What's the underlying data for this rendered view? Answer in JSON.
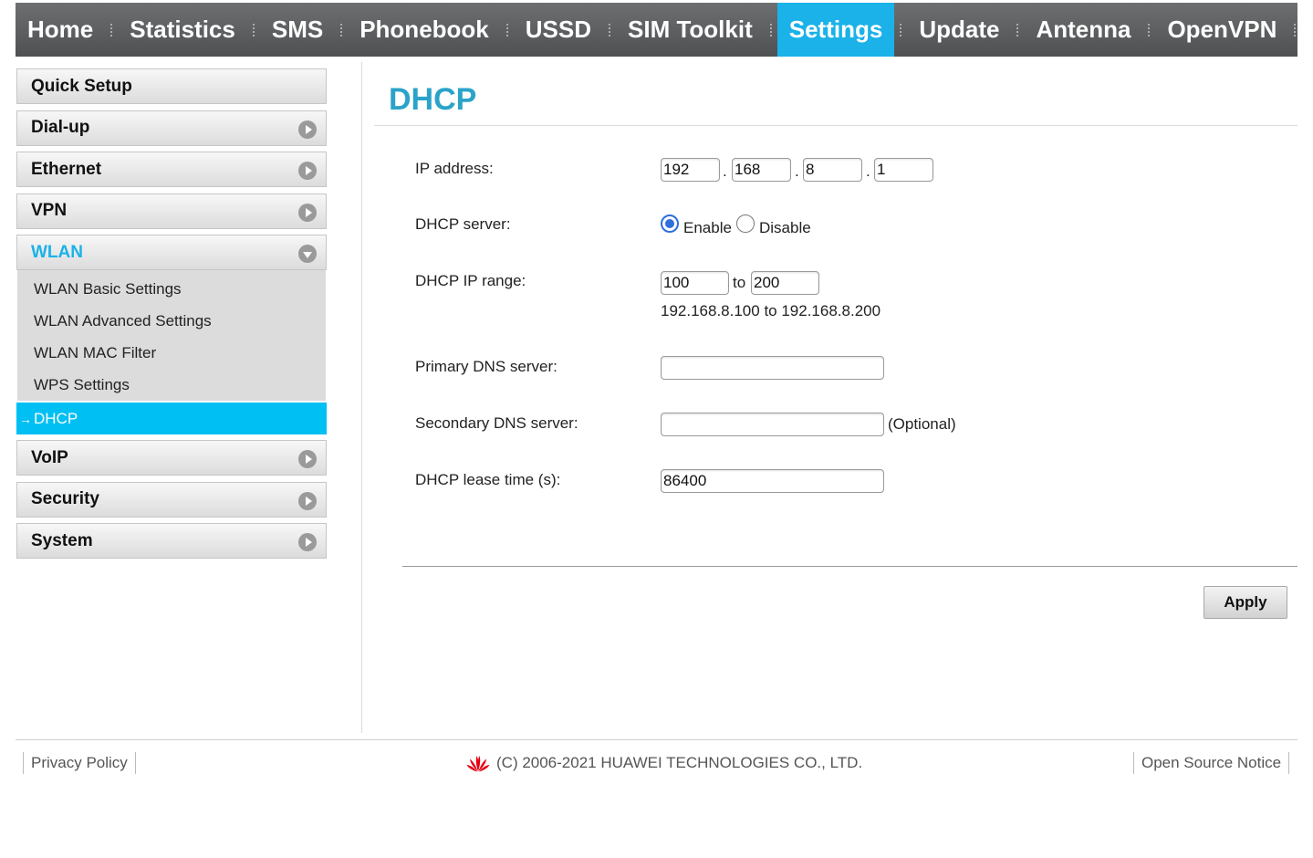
{
  "nav": {
    "items": [
      {
        "label": "Home"
      },
      {
        "label": "Statistics"
      },
      {
        "label": "SMS"
      },
      {
        "label": "Phonebook"
      },
      {
        "label": "USSD"
      },
      {
        "label": "SIM Toolkit"
      },
      {
        "label": "Settings"
      },
      {
        "label": "Update"
      },
      {
        "label": "Antenna"
      },
      {
        "label": "OpenVPN"
      }
    ],
    "active": "Settings"
  },
  "sidebar": {
    "items": [
      {
        "label": "Quick Setup"
      },
      {
        "label": "Dial-up"
      },
      {
        "label": "Ethernet"
      },
      {
        "label": "VPN"
      },
      {
        "label": "WLAN"
      },
      {
        "label": "VoIP"
      },
      {
        "label": "Security"
      },
      {
        "label": "System"
      }
    ],
    "wlan_sub": [
      {
        "label": "WLAN Basic Settings"
      },
      {
        "label": "WLAN Advanced Settings"
      },
      {
        "label": "WLAN MAC Filter"
      },
      {
        "label": "WPS Settings"
      },
      {
        "label": "DHCP"
      }
    ]
  },
  "page": {
    "title": "DHCP",
    "ip_address": {
      "label": "IP address:",
      "octets": [
        "192",
        "168",
        "8",
        "1"
      ],
      "separator": "."
    },
    "dhcp_server": {
      "label": "DHCP server:",
      "enable": "Enable",
      "disable": "Disable",
      "selected": "Enable"
    },
    "ip_range": {
      "label": "DHCP IP range:",
      "start": "100",
      "to": "to",
      "end": "200",
      "summary": "192.168.8.100 to 192.168.8.200"
    },
    "primary_dns": {
      "label": "Primary DNS server:",
      "value": ""
    },
    "secondary_dns": {
      "label": "Secondary DNS server:",
      "value": "",
      "note": "(Optional)"
    },
    "lease_time": {
      "label": "DHCP lease time (s):",
      "value": "86400"
    },
    "apply_label": "Apply"
  },
  "footer": {
    "privacy": "Privacy Policy",
    "copyright": "(C) 2006-2021 HUAWEI TECHNOLOGIES CO., LTD.",
    "open_source": "Open Source Notice"
  },
  "colors": {
    "nav_active": "#1ab2e8",
    "sidebar_active": "#00bff3",
    "title": "#2ba3c9",
    "radio_selected": "#2f6fdc",
    "logo": "#e60012"
  }
}
